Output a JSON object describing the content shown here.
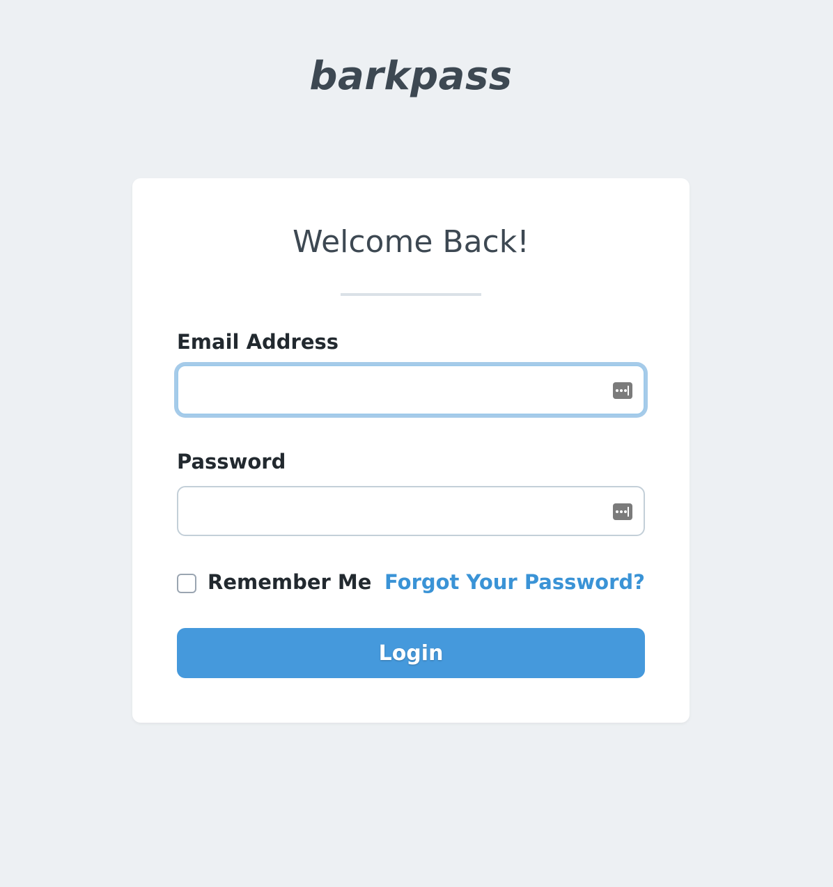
{
  "brand": {
    "name": "barkpass"
  },
  "login_card": {
    "title": "Welcome Back!",
    "email": {
      "label": "Email Address",
      "value": "",
      "placeholder": "",
      "icon": "password-manager-icon"
    },
    "password": {
      "label": "Password",
      "value": "",
      "placeholder": "",
      "icon": "password-manager-icon"
    },
    "remember_me": {
      "label": "Remember Me",
      "checked": false
    },
    "forgot_password_link": "Forgot Your Password?",
    "submit_label": "Login"
  },
  "colors": {
    "background": "#edf0f3",
    "brand_text": "#3d4852",
    "accent": "#4599dc",
    "link": "#3a93d6",
    "focus_ring": "#a6cbe9"
  }
}
